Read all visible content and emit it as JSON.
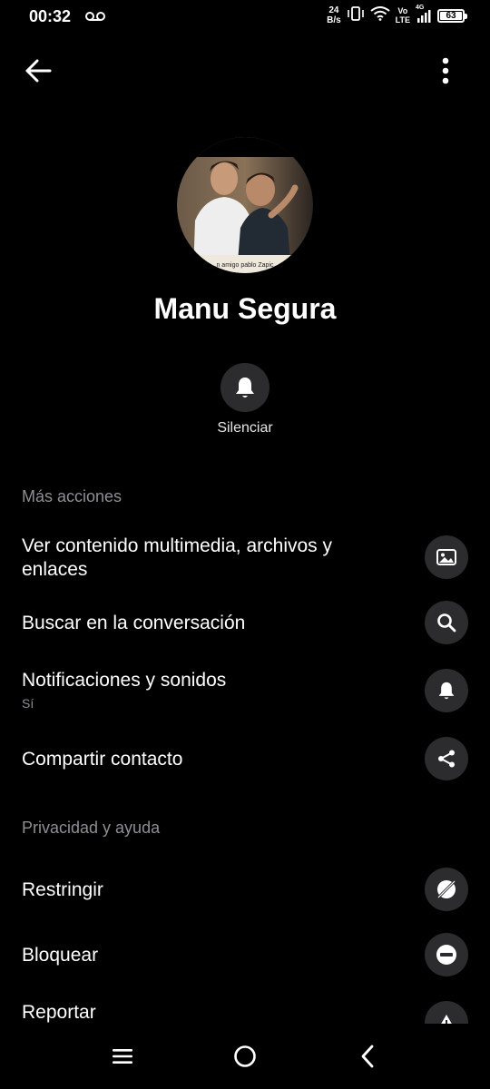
{
  "status_bar": {
    "time": "00:32",
    "speed_value": "24",
    "speed_unit": "B/s",
    "volte_top": "Vo",
    "volte_bottom": "LTE",
    "network": "4G",
    "battery_level": "63"
  },
  "profile": {
    "name": "Manu Segura",
    "mute_label": "Silenciar",
    "photo_caption": "n amigo pablo Zapic"
  },
  "sections": {
    "more_actions": "Más acciones",
    "privacy_help": "Privacidad y ayuda"
  },
  "rows": {
    "media": {
      "title": "Ver contenido multimedia, archivos y enlaces",
      "icon": "image-icon"
    },
    "search": {
      "title": "Buscar en la conversación",
      "icon": "search-icon"
    },
    "notifications": {
      "title": "Notificaciones y sonidos",
      "subtitle": "Sí",
      "icon": "bell-icon"
    },
    "share": {
      "title": "Compartir contacto",
      "icon": "share-icon"
    },
    "restrict": {
      "title": "Restringir",
      "icon": "restrict-icon"
    },
    "block": {
      "title": "Bloquear",
      "icon": "block-icon"
    },
    "report": {
      "title": "Reportar",
      "icon": "warning-icon"
    }
  },
  "colors": {
    "background": "#000000",
    "icon_circle": "#2c2c2e",
    "secondary_text": "#8e8e93"
  }
}
